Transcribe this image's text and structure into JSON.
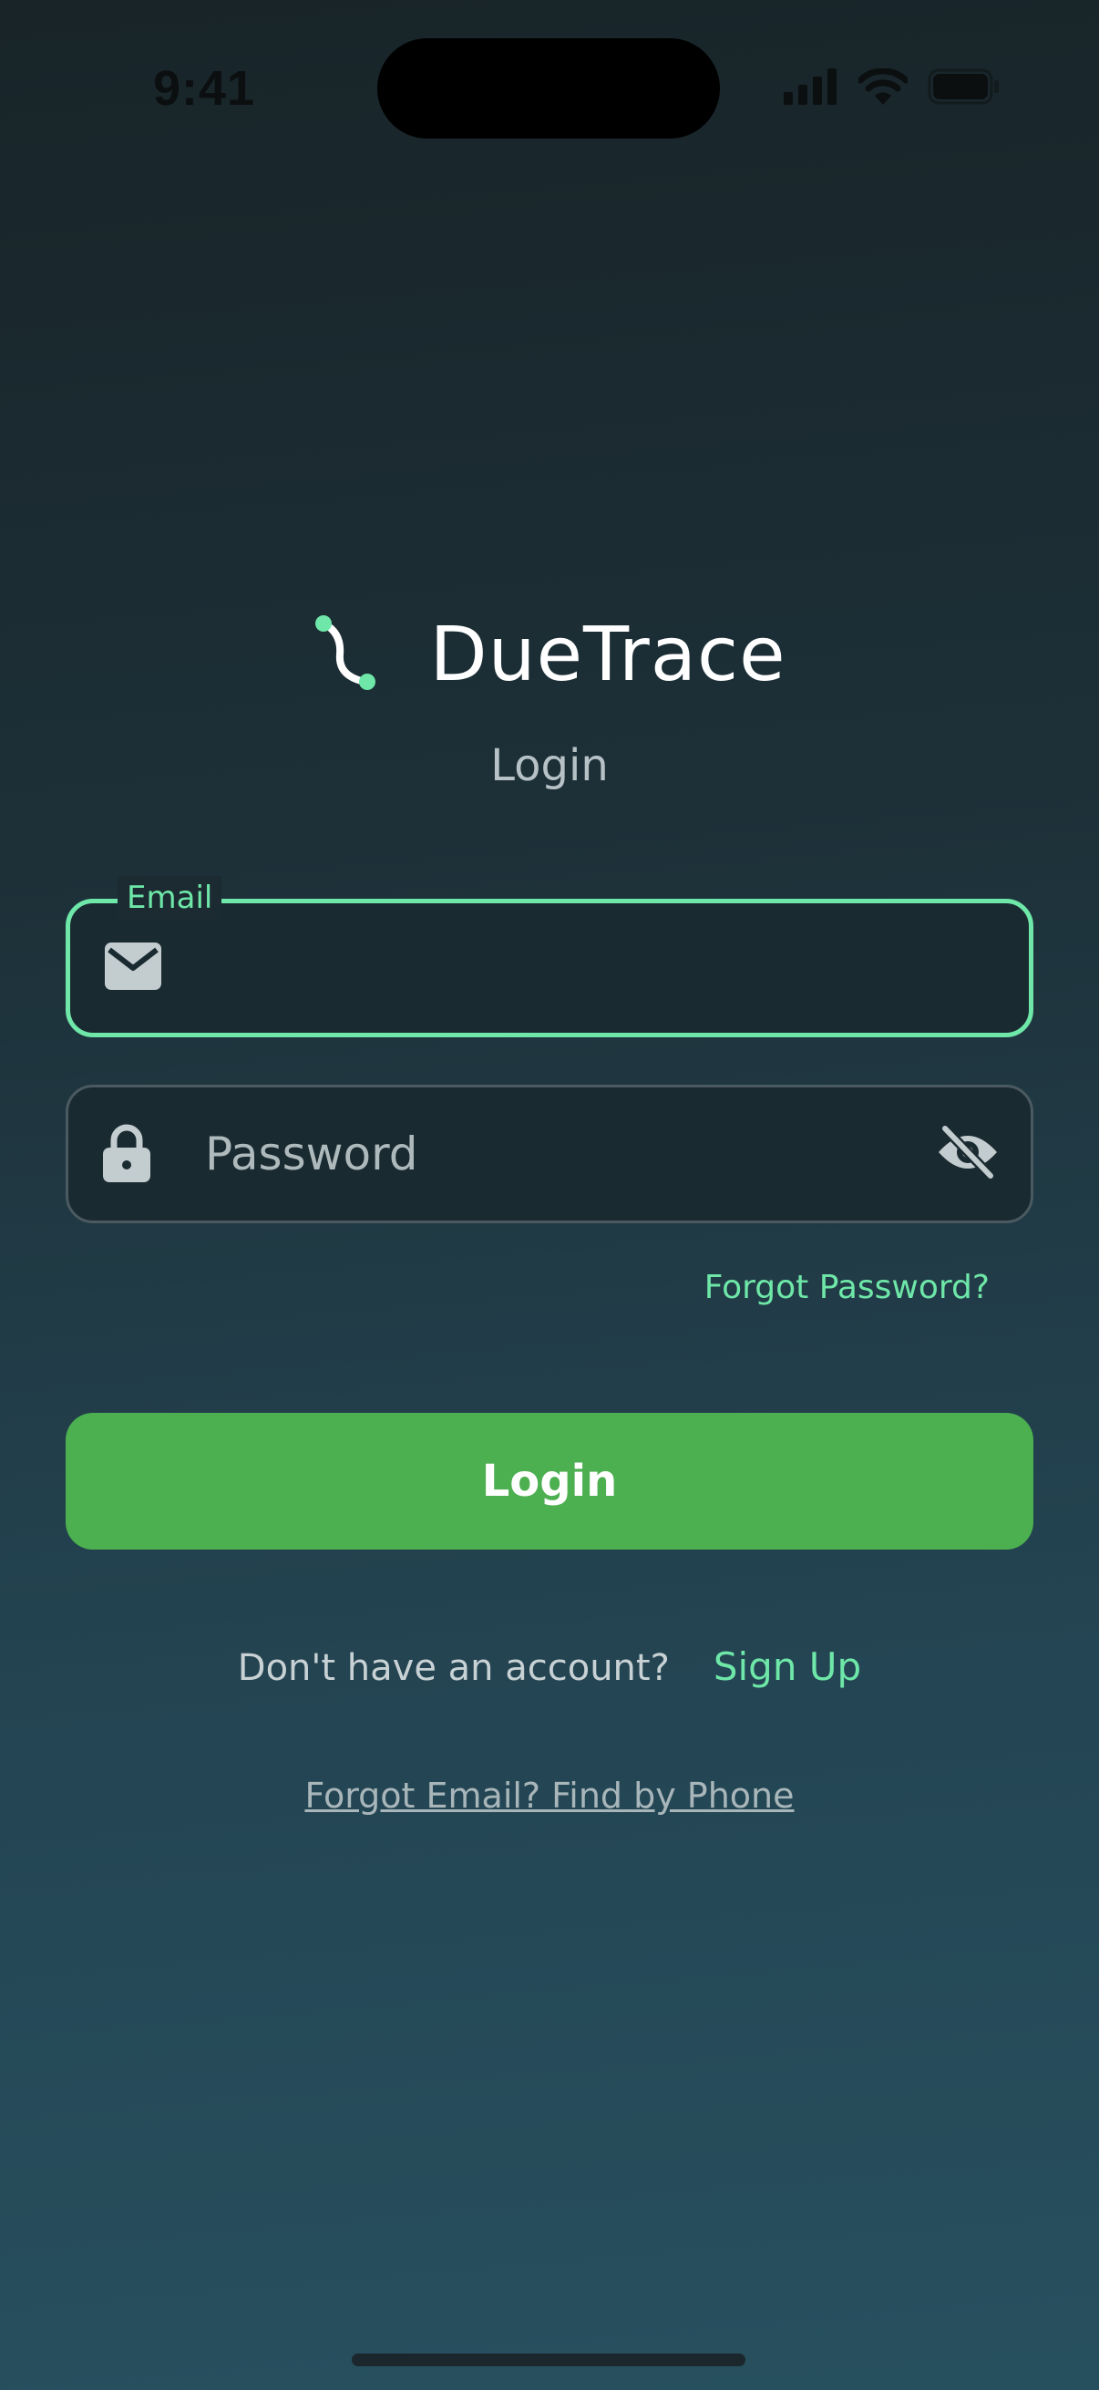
{
  "status_bar": {
    "time": "9:41",
    "icons": [
      "cellular-signal-icon",
      "wifi-icon",
      "battery-icon"
    ]
  },
  "brand": {
    "name": "DueTrace",
    "logo_icon": "path-trace-icon",
    "accent_color": "#6ee7a8"
  },
  "page": {
    "subtitle": "Login"
  },
  "form": {
    "email": {
      "label": "Email",
      "value": "",
      "placeholder": "",
      "icon": "envelope-icon"
    },
    "password": {
      "label": "",
      "value": "",
      "placeholder": "Password",
      "icon": "lock-icon",
      "visibility_icon": "eye-off-icon"
    },
    "forgot_password": "Forgot Password?",
    "submit_label": "Login",
    "submit_color": "#4caf50"
  },
  "footer": {
    "signup_prompt": "Don't have an account?",
    "signup_link": "Sign Up",
    "find_email_link": "Forgot Email? Find by Phone"
  }
}
